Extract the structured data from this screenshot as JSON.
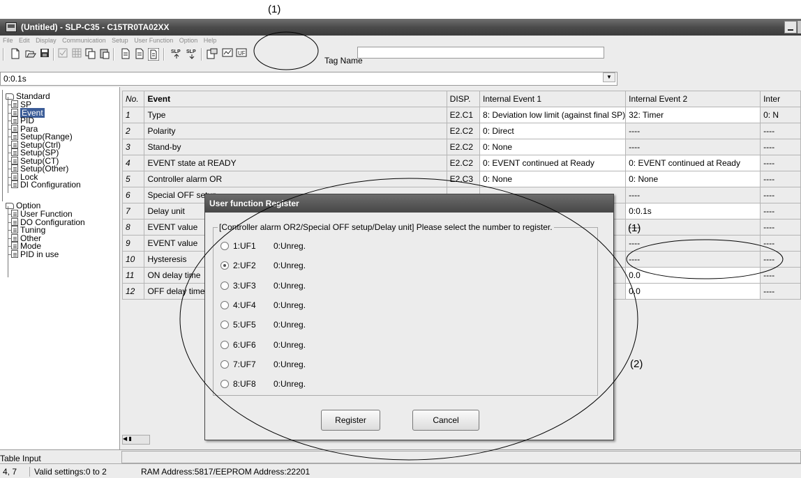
{
  "annotations": {
    "top_callout": "(1)",
    "right_callout": "(1)",
    "dialog_callout": "(2)"
  },
  "window": {
    "title": "(Untitled) - SLP-C35 - C15TR0TA02XX"
  },
  "menu": [
    "File",
    "Edit",
    "Display",
    "Communication",
    "Setup",
    "User Function",
    "Option",
    "Help"
  ],
  "toolbar": {
    "tag_name_label": "Tag Name",
    "tag_name_value": "",
    "icons": [
      "new-icon",
      "open-icon",
      "save-icon",
      "check-icon",
      "grid-icon",
      "copy-icon",
      "paste-icon",
      "doc-icon",
      "doc2-icon",
      "doc3-icon",
      "slp-upload-icon",
      "slp-download-icon",
      "properties-icon",
      "monitor-icon",
      "user-function-icon"
    ]
  },
  "value_bar": {
    "current": "0:0.1s"
  },
  "tree": {
    "root1": "Standard",
    "standard_items": [
      "SP",
      "Event",
      "PID",
      "Para",
      "Setup(Range)",
      "Setup(Ctrl)",
      "Setup(SP)",
      "Setup(CT)",
      "Setup(Other)",
      "Lock",
      "DI Configuration"
    ],
    "root2": "Option",
    "option_items": [
      "User Function",
      "DO Configuration",
      "Tuning",
      "Other",
      "Mode",
      "PID in use"
    ],
    "selected": "Event"
  },
  "table": {
    "headers": [
      "No.",
      "Event",
      "DISP.",
      "Internal Event 1",
      "Internal Event 2",
      "Inter"
    ],
    "rows": [
      {
        "no": "1",
        "name": "Type",
        "disp": "E2.C1",
        "ie1": "8: Deviation low limit (against final SP)",
        "ie2": "32: Timer",
        "ie3": "0: N"
      },
      {
        "no": "2",
        "name": "Polarity",
        "disp": "E2.C2",
        "ie1": "0: Direct",
        "ie2": "----",
        "ie3": "----"
      },
      {
        "no": "3",
        "name": "Stand-by",
        "disp": "E2.C2",
        "ie1": "0: None",
        "ie2": "----",
        "ie3": "----"
      },
      {
        "no": "4",
        "name": "EVENT state at READY",
        "disp": "E2.C2",
        "ie1": "0: EVENT continued at Ready",
        "ie2": "0: EVENT continued at Ready",
        "ie3": "----"
      },
      {
        "no": "5",
        "name": "Controller alarm OR",
        "disp": "E2.C3",
        "ie1": "0: None",
        "ie2": "0: None",
        "ie3": "----"
      },
      {
        "no": "6",
        "name": "Special OFF setup",
        "disp": "",
        "ie1": "",
        "ie2": "----",
        "ie3": "----"
      },
      {
        "no": "7",
        "name": "Delay unit",
        "disp": "",
        "ie1": "",
        "ie2": "0:0.1s",
        "ie3": "----"
      },
      {
        "no": "8",
        "name": "EVENT value",
        "disp": "",
        "ie1": "",
        "ie2": "----",
        "ie3": "----"
      },
      {
        "no": "9",
        "name": "EVENT value",
        "disp": "",
        "ie1": "",
        "ie2": "----",
        "ie3": "----"
      },
      {
        "no": "10",
        "name": "Hysteresis",
        "disp": "",
        "ie1": "",
        "ie2": "----",
        "ie3": "----"
      },
      {
        "no": "11",
        "name": "ON delay time",
        "disp": "",
        "ie1": "",
        "ie2": "0.0",
        "ie3": "----"
      },
      {
        "no": "12",
        "name": "OFF delay time",
        "disp": "",
        "ie1": "",
        "ie2": "0.0",
        "ie3": "----"
      }
    ]
  },
  "dialog": {
    "title": "User function Register",
    "instruction": "[Controller alarm OR2/Special OFF setup/Delay unit] Please select the number to register.",
    "options": [
      {
        "label": "1:UF1",
        "status": "0:Unreg.",
        "checked": false
      },
      {
        "label": "2:UF2",
        "status": "0:Unreg.",
        "checked": true
      },
      {
        "label": "3:UF3",
        "status": "0:Unreg.",
        "checked": false
      },
      {
        "label": "4:UF4",
        "status": "0:Unreg.",
        "checked": false
      },
      {
        "label": "5:UF5",
        "status": "0:Unreg.",
        "checked": false
      },
      {
        "label": "6:UF6",
        "status": "0:Unreg.",
        "checked": false
      },
      {
        "label": "7:UF7",
        "status": "0:Unreg.",
        "checked": false
      },
      {
        "label": "8:UF8",
        "status": "0:Unreg.",
        "checked": false
      }
    ],
    "register_label": "Register",
    "cancel_label": "Cancel"
  },
  "status": {
    "table_input": "Table Input",
    "position": "4, 7",
    "valid_settings": "Valid settings:0 to 2",
    "address": "RAM Address:5817/EEPROM Address:22201"
  }
}
